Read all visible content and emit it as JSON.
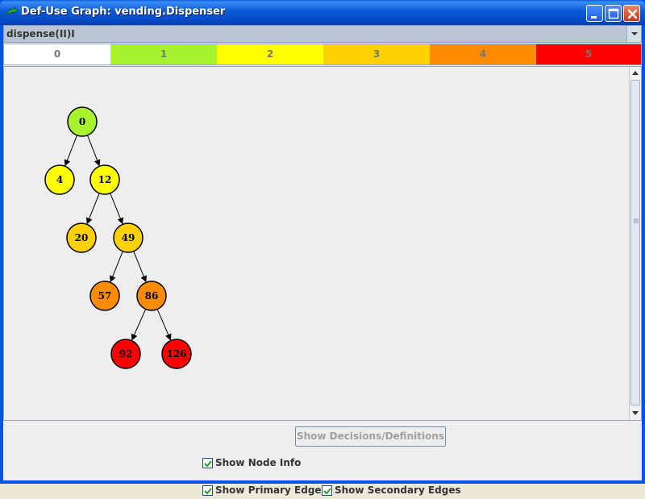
{
  "window": {
    "title": "Def-Use Graph: vending.Dispenser"
  },
  "method_selector": {
    "selected": "dispense(II)I"
  },
  "legend": [
    {
      "label": "0",
      "color": "#FFFFFF"
    },
    {
      "label": "1",
      "color": "#A8F22E"
    },
    {
      "label": "2",
      "color": "#FFFF00"
    },
    {
      "label": "3",
      "color": "#FFD100"
    },
    {
      "label": "4",
      "color": "#FF8C00"
    },
    {
      "label": "5",
      "color": "#FF0000"
    }
  ],
  "graph": {
    "nodes": [
      {
        "id": "0",
        "level": 1
      },
      {
        "id": "4",
        "level": 2
      },
      {
        "id": "12",
        "level": 2
      },
      {
        "id": "20",
        "level": 3
      },
      {
        "id": "49",
        "level": 3
      },
      {
        "id": "57",
        "level": 4
      },
      {
        "id": "86",
        "level": 4
      },
      {
        "id": "92",
        "level": 5
      },
      {
        "id": "126",
        "level": 5
      }
    ],
    "edges": [
      [
        "0",
        "4"
      ],
      [
        "0",
        "12"
      ],
      [
        "12",
        "20"
      ],
      [
        "12",
        "49"
      ],
      [
        "49",
        "57"
      ],
      [
        "49",
        "86"
      ],
      [
        "86",
        "92"
      ],
      [
        "86",
        "126"
      ]
    ]
  },
  "controls": {
    "show_node_info": {
      "label": "Show Node Info",
      "checked": true
    },
    "decisions_button": {
      "label": "Show Decisions/Definitions",
      "enabled": false
    },
    "show_primary_edges": {
      "label": "Show Primary Edges",
      "checked": true
    },
    "show_secondary_edges": {
      "label": "Show Secondary Edges",
      "checked": true
    }
  }
}
